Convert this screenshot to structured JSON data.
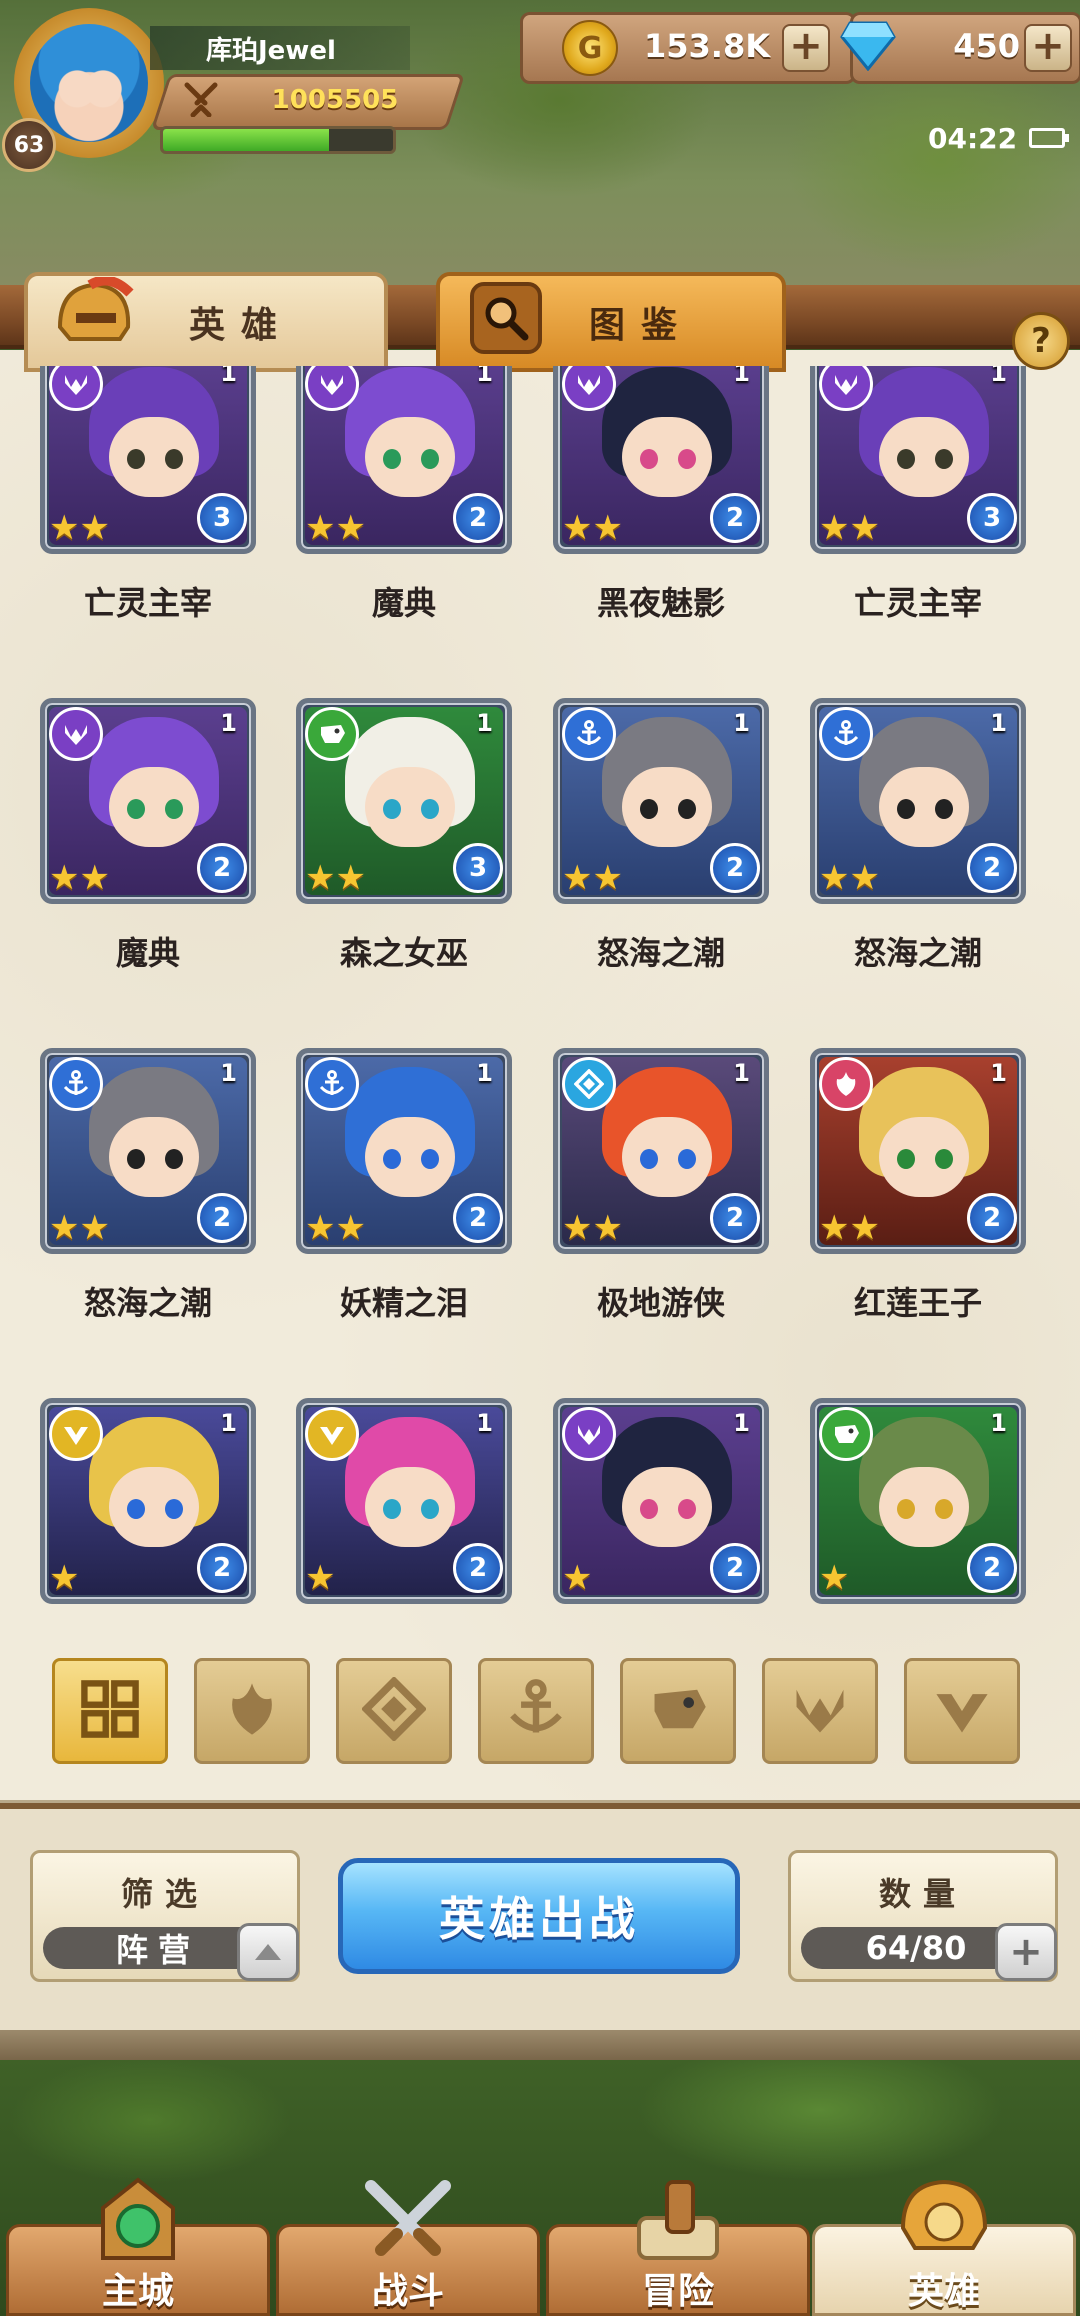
{
  "player": {
    "name": "库珀Jewel",
    "level": "63",
    "power": "1005505",
    "exp_fraction": 0.72
  },
  "resources": {
    "gold": "153.8K",
    "gems": "450"
  },
  "status": {
    "time": "04:22"
  },
  "tabs": {
    "heroes": "英雄",
    "codex": "图鉴",
    "help": "?"
  },
  "heroes": [
    {
      "name": "亡灵主宰",
      "faction": "demon",
      "level": "1",
      "stars": 2,
      "grade": "3"
    },
    {
      "name": "魔典",
      "faction": "demon",
      "level": "1",
      "stars": 2,
      "grade": "2"
    },
    {
      "name": "黑夜魅影",
      "faction": "demon",
      "level": "1",
      "stars": 2,
      "grade": "2"
    },
    {
      "name": "亡灵主宰",
      "faction": "demon",
      "level": "1",
      "stars": 2,
      "grade": "3"
    },
    {
      "name": "魔典",
      "faction": "demon",
      "level": "1",
      "stars": 2,
      "grade": "2"
    },
    {
      "name": "森之女巫",
      "faction": "beast",
      "level": "1",
      "stars": 2,
      "grade": "3"
    },
    {
      "name": "怒海之潮",
      "faction": "anchor",
      "level": "1",
      "stars": 2,
      "grade": "2"
    },
    {
      "name": "怒海之潮",
      "faction": "anchor",
      "level": "1",
      "stars": 2,
      "grade": "2"
    },
    {
      "name": "怒海之潮",
      "faction": "anchor",
      "level": "1",
      "stars": 2,
      "grade": "2"
    },
    {
      "name": "妖精之泪",
      "faction": "anchor",
      "level": "1",
      "stars": 2,
      "grade": "2"
    },
    {
      "name": "极地游侠",
      "faction": "diamond",
      "level": "1",
      "stars": 2,
      "grade": "2"
    },
    {
      "name": "红莲王子",
      "faction": "flame",
      "level": "1",
      "stars": 2,
      "grade": "2"
    },
    {
      "name": "",
      "faction": "light",
      "level": "1",
      "stars": 1,
      "grade": "2"
    },
    {
      "name": "",
      "faction": "light",
      "level": "1",
      "stars": 1,
      "grade": "2"
    },
    {
      "name": "",
      "faction": "demon",
      "level": "1",
      "stars": 1,
      "grade": "2"
    },
    {
      "name": "",
      "faction": "beast",
      "level": "1",
      "stars": 1,
      "grade": "2"
    }
  ],
  "faction_colors": {
    "demon": "#7a3fc4",
    "beast": "#3aa83a",
    "anchor": "#2f6fd6",
    "diamond": "#2aa6e0",
    "flame": "#d84467",
    "light": "#e2b624"
  },
  "filters": [
    "all-icon",
    "flame-icon",
    "diamond-icon",
    "anchor-icon",
    "beast-icon",
    "demon-icon",
    "light-icon"
  ],
  "controls": {
    "filter_title": "筛选",
    "filter_value": "阵营",
    "deploy": "英雄出战",
    "count_title": "数量",
    "count_value": "64/80"
  },
  "nav": [
    {
      "label": "主城",
      "icon": "main-city-icon"
    },
    {
      "label": "战斗",
      "icon": "battle-icon"
    },
    {
      "label": "冒险",
      "icon": "adventure-icon"
    },
    {
      "label": "英雄",
      "icon": "hero-icon"
    }
  ]
}
